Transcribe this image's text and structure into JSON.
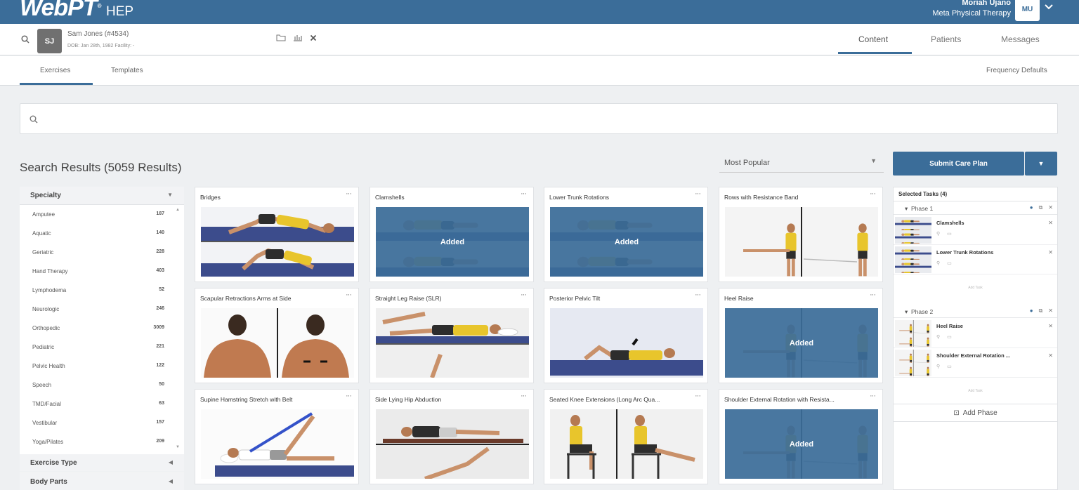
{
  "app": {
    "logo": "WebPT",
    "logo_mark": "®",
    "product": "HEP"
  },
  "user": {
    "name": "Moriah Ujano",
    "org": "Meta Physical Therapy",
    "initials": "MU"
  },
  "patient": {
    "initials": "SJ",
    "name": "Sam Jones (#4534)",
    "details": "DOB: Jan 28th, 1982   Facility: -"
  },
  "main_tabs": [
    {
      "label": "Content",
      "active": true
    },
    {
      "label": "Patients",
      "active": false
    },
    {
      "label": "Messages",
      "active": false
    }
  ],
  "sub_tabs": [
    {
      "label": "Exercises",
      "active": true
    },
    {
      "label": "Templates",
      "active": false
    }
  ],
  "frequency_defaults": "Frequency Defaults",
  "search": {
    "placeholder": ""
  },
  "results_title": "Search Results (5059 Results)",
  "sort": {
    "value": "Most Popular"
  },
  "submit_button": "Submit Care Plan",
  "filters": {
    "specialty": {
      "label": "Specialty",
      "items": [
        {
          "name": "Amputee",
          "count": "187"
        },
        {
          "name": "Aquatic",
          "count": "140"
        },
        {
          "name": "Geriatric",
          "count": "228"
        },
        {
          "name": "Hand Therapy",
          "count": "403"
        },
        {
          "name": "Lymphodema",
          "count": "52"
        },
        {
          "name": "Neurologic",
          "count": "246"
        },
        {
          "name": "Orthopedic",
          "count": "3009"
        },
        {
          "name": "Pediatric",
          "count": "221"
        },
        {
          "name": "Pelvic Health",
          "count": "122"
        },
        {
          "name": "Speech",
          "count": "50"
        },
        {
          "name": "TMD/Facial",
          "count": "63"
        },
        {
          "name": "Vestibular",
          "count": "157"
        },
        {
          "name": "Yoga/Pilates",
          "count": "209"
        }
      ]
    },
    "exercise_type": {
      "label": "Exercise Type"
    },
    "body_parts": {
      "label": "Body Parts"
    }
  },
  "exercises": [
    {
      "title": "Bridges",
      "added": false,
      "pose": "bridge"
    },
    {
      "title": "Clamshells",
      "added": true,
      "pose": "lying"
    },
    {
      "title": "Lower Trunk Rotations",
      "added": true,
      "pose": "lying"
    },
    {
      "title": "Rows with Resistance Band",
      "added": false,
      "pose": "standing-split"
    },
    {
      "title": "Scapular Retractions Arms at Side",
      "added": false,
      "pose": "backs"
    },
    {
      "title": "Straight Leg Raise (SLR)",
      "added": false,
      "pose": "slr"
    },
    {
      "title": "Posterior Pelvic Tilt",
      "added": false,
      "pose": "tilt"
    },
    {
      "title": "Heel Raise",
      "added": true,
      "pose": "standing-split"
    },
    {
      "title": "Supine Hamstring Stretch with Belt",
      "added": false,
      "pose": "hamstring"
    },
    {
      "title": "Side Lying Hip Abduction",
      "added": false,
      "pose": "sidelying"
    },
    {
      "title": "Seated Knee Extensions (Long Arc Qua...",
      "added": false,
      "pose": "seated"
    },
    {
      "title": "Shoulder External Rotation with Resista...",
      "added": true,
      "pose": "standing-split"
    }
  ],
  "added_label": "Added",
  "tasks": {
    "title": "Selected Tasks (4)",
    "phases": [
      {
        "label": "Phase 1",
        "items": [
          {
            "name": "Clamshells"
          },
          {
            "name": "Lower Trunk Rotations"
          }
        ]
      },
      {
        "label": "Phase 2",
        "items": [
          {
            "name": "Heel Raise"
          },
          {
            "name": "Shoulder External Rotation ..."
          }
        ]
      }
    ],
    "add_task": "Add Task",
    "add_phase": "Add Phase",
    "item_meta": "⚲ ▭"
  },
  "colors": {
    "brand": "#3b6d99",
    "background": "#eef0f2",
    "overlay": "#3b6d99"
  },
  "icons": [
    "search-icon",
    "folder-icon",
    "chart-icon",
    "close-icon",
    "chevron-down-icon",
    "more-icon",
    "check-circle-icon",
    "copy-icon",
    "add-icon"
  ]
}
